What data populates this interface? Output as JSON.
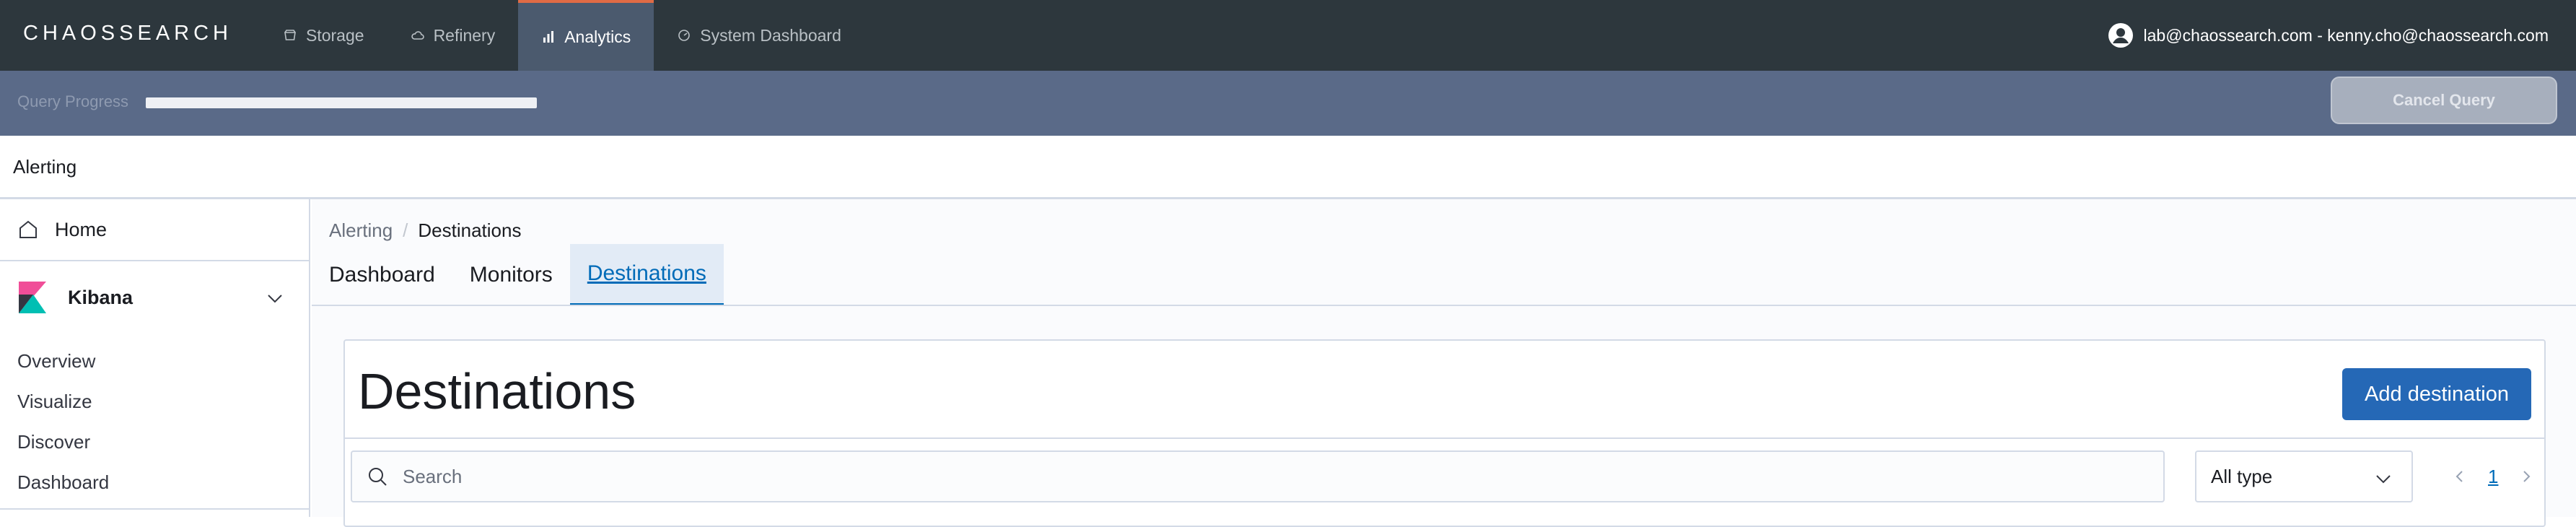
{
  "brand": {
    "logo_text": "CHAOSSEARCH"
  },
  "nav": {
    "items": [
      {
        "label": "Storage",
        "icon": "storage-icon"
      },
      {
        "label": "Refinery",
        "icon": "cloud-icon"
      },
      {
        "label": "Analytics",
        "icon": "bar-chart-icon",
        "active": true
      },
      {
        "label": "System Dashboard",
        "icon": "dashboard-icon"
      }
    ],
    "user": "lab@chaossearch.com - kenny.cho@chaossearch.com"
  },
  "query": {
    "label": "Query Progress",
    "cancel_label": "Cancel Query",
    "progress": 1.0
  },
  "app": {
    "title": "Alerting"
  },
  "sidebar": {
    "home_label": "Home",
    "kibana_label": "Kibana",
    "links": [
      "Overview",
      "Visualize",
      "Discover",
      "Dashboard"
    ]
  },
  "breadcrumb": {
    "parent": "Alerting",
    "separator": "/",
    "current": "Destinations"
  },
  "tabs": [
    {
      "label": "Dashboard"
    },
    {
      "label": "Monitors"
    },
    {
      "label": "Destinations",
      "active": true
    }
  ],
  "panel": {
    "title": "Destinations",
    "add_label": "Add destination",
    "search_placeholder": "Search",
    "type_select": "All type",
    "page": "1"
  },
  "colors": {
    "topbar": "#2d373d",
    "accent": "#e06b45",
    "primary": "#2568b6",
    "link": "#006bb8"
  }
}
